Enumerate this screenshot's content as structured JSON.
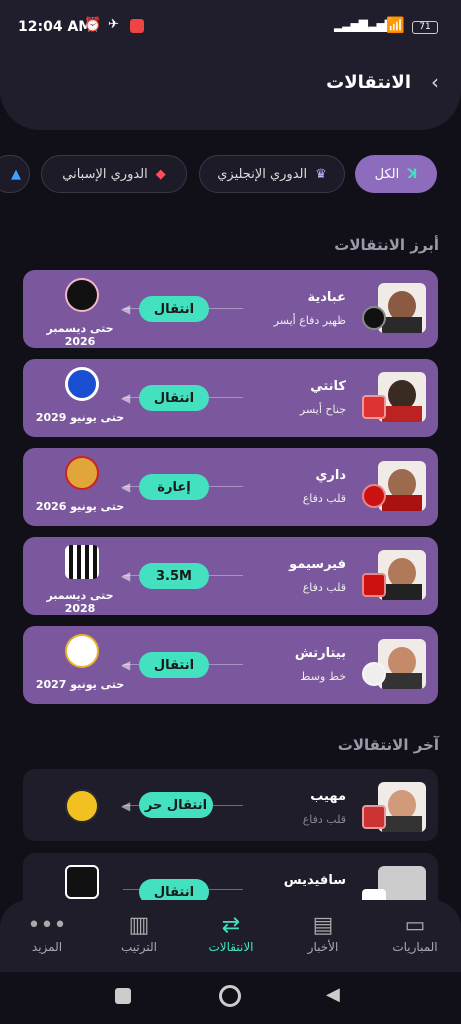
{
  "status": {
    "time": "12:04 AM",
    "battery": "71"
  },
  "header": {
    "title": "الانتقالات"
  },
  "filters": [
    {
      "label": "الكل",
      "active": true
    },
    {
      "label": "الدوري الإنجليزي"
    },
    {
      "label": "الدوري الإسباني"
    }
  ],
  "sections": {
    "top": "أبرز الانتقالات",
    "latest": "آخر الانتقالات"
  },
  "top_transfers": [
    {
      "name": "عبادية",
      "position": "ظهير دفاع أيسر",
      "type": "انتقال",
      "until": "حتى ديسمبر 2026"
    },
    {
      "name": "كانتي",
      "position": "جناح أيسر",
      "type": "انتقال",
      "until": "حتى يونيو 2029"
    },
    {
      "name": "داري",
      "position": "قلب دفاع",
      "type": "إعارة",
      "until": "حتى يونيو 2026"
    },
    {
      "name": "فيرسيمو",
      "position": "قلب دفاع",
      "type": "3.5M",
      "until": "حتى ديسمبر 2028"
    },
    {
      "name": "بيتارتش",
      "position": "خط وسط",
      "type": "انتقال",
      "until": "حتى يونيو 2027"
    }
  ],
  "latest_transfers": [
    {
      "name": "مهيب",
      "position": "قلب دفاع",
      "type": "انتقال حر"
    },
    {
      "name": "سافيديس",
      "position": "",
      "type": "انتقال"
    }
  ],
  "nav": [
    {
      "label": "المباريات",
      "icon": "pitch-icon"
    },
    {
      "label": "الأخبار",
      "icon": "news-icon"
    },
    {
      "label": "الانتقالات",
      "icon": "transfers-icon",
      "active": true
    },
    {
      "label": "الترتيب",
      "icon": "standings-icon"
    },
    {
      "label": "المزيد",
      "icon": "more-icon"
    }
  ]
}
